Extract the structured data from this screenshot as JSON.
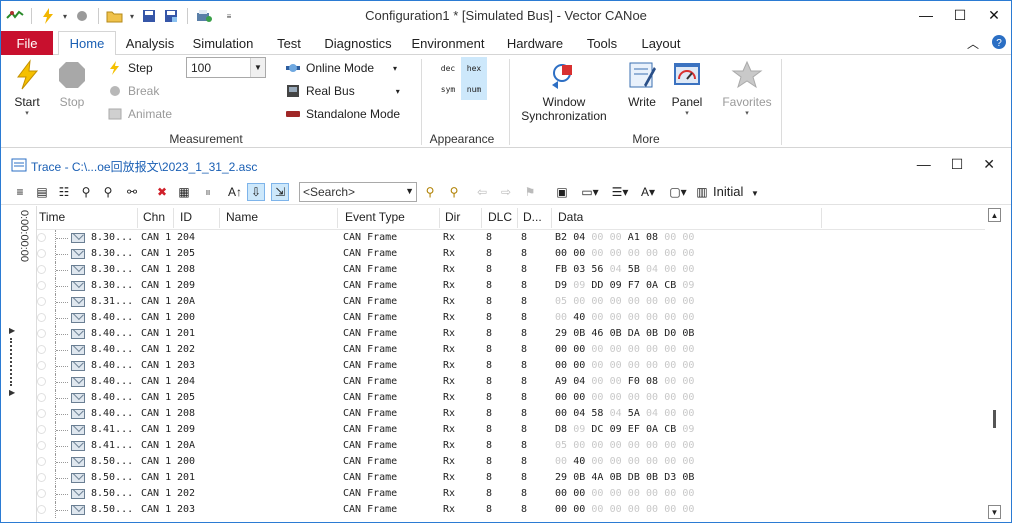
{
  "window": {
    "title": "Configuration1 * [Simulated Bus] - Vector CANoe"
  },
  "quick_access": {
    "icons": [
      "network-icon",
      "start-icon",
      "stop-icon",
      "open-folder-icon",
      "save-icon",
      "save-as-icon",
      "print-icon",
      "customize-icon"
    ]
  },
  "ribbon_tabs": [
    "File",
    "Home",
    "Analysis",
    "Simulation",
    "Test",
    "Diagnostics",
    "Environment",
    "Hardware",
    "Tools",
    "Layout"
  ],
  "ribbon": {
    "measurement": {
      "label": "Measurement",
      "start": "Start",
      "stop": "Stop",
      "step": "Step",
      "break": "Break",
      "animate": "Animate",
      "speed_value": "100",
      "online_mode": "Online Mode",
      "real_bus": "Real Bus",
      "standalone_mode": "Standalone Mode"
    },
    "appearance": {
      "label": "Appearance",
      "formats": [
        "dec",
        "hex",
        "sym",
        "num"
      ]
    },
    "more": {
      "label": "More",
      "window_sync_line1": "Window",
      "window_sync_line2": "Synchronization",
      "write": "Write",
      "panel": "Panel",
      "favorites": "Favorites"
    }
  },
  "trace": {
    "title": "Trace - C:\\...oe回放报文\\2023_1_31_2.asc",
    "search_placeholder": "<Search>",
    "layout_label": "Initial",
    "time_stamp": "0:00:00:00",
    "columns": [
      "Time",
      "Chn",
      "ID",
      "Name",
      "Event Type",
      "Dir",
      "DLC",
      "D...",
      "Data"
    ],
    "rows": [
      {
        "time": "8.30...",
        "chn": "CAN 1",
        "id": "204",
        "name": "",
        "event": "CAN Frame",
        "dir": "Rx",
        "dlc": "8",
        "d": "8",
        "data": [
          "B2",
          "04",
          "00",
          "00",
          "A1",
          "08",
          "00",
          "00"
        ],
        "faint": [
          2,
          3,
          6,
          7
        ]
      },
      {
        "time": "8.30...",
        "chn": "CAN 1",
        "id": "205",
        "name": "",
        "event": "CAN Frame",
        "dir": "Rx",
        "dlc": "8",
        "d": "8",
        "data": [
          "00",
          "00",
          "00",
          "00",
          "00",
          "00",
          "00",
          "00"
        ],
        "faint": [
          2,
          3,
          4,
          5,
          6,
          7
        ]
      },
      {
        "time": "8.30...",
        "chn": "CAN 1",
        "id": "208",
        "name": "",
        "event": "CAN Frame",
        "dir": "Rx",
        "dlc": "8",
        "d": "8",
        "data": [
          "FB",
          "03",
          "56",
          "04",
          "5B",
          "04",
          "00",
          "00"
        ],
        "faint": [
          3,
          5,
          6,
          7
        ]
      },
      {
        "time": "8.30...",
        "chn": "CAN 1",
        "id": "209",
        "name": "",
        "event": "CAN Frame",
        "dir": "Rx",
        "dlc": "8",
        "d": "8",
        "data": [
          "D9",
          "09",
          "DD",
          "09",
          "F7",
          "0A",
          "CB",
          "09"
        ],
        "faint": [
          1,
          7
        ]
      },
      {
        "time": "8.31...",
        "chn": "CAN 1",
        "id": "20A",
        "name": "",
        "event": "CAN Frame",
        "dir": "Rx",
        "dlc": "8",
        "d": "8",
        "data": [
          "05",
          "00",
          "00",
          "00",
          "00",
          "00",
          "00",
          "00"
        ],
        "faint": [
          0,
          1,
          2,
          3,
          4,
          5,
          6,
          7
        ]
      },
      {
        "time": "8.40...",
        "chn": "CAN 1",
        "id": "200",
        "name": "",
        "event": "CAN Frame",
        "dir": "Rx",
        "dlc": "8",
        "d": "8",
        "data": [
          "00",
          "40",
          "00",
          "00",
          "00",
          "00",
          "00",
          "00"
        ],
        "faint": [
          0,
          2,
          3,
          4,
          5,
          6,
          7
        ]
      },
      {
        "time": "8.40...",
        "chn": "CAN 1",
        "id": "201",
        "name": "",
        "event": "CAN Frame",
        "dir": "Rx",
        "dlc": "8",
        "d": "8",
        "data": [
          "29",
          "0B",
          "46",
          "0B",
          "DA",
          "0B",
          "D0",
          "0B"
        ],
        "faint": []
      },
      {
        "time": "8.40...",
        "chn": "CAN 1",
        "id": "202",
        "name": "",
        "event": "CAN Frame",
        "dir": "Rx",
        "dlc": "8",
        "d": "8",
        "data": [
          "00",
          "00",
          "00",
          "00",
          "00",
          "00",
          "00",
          "00"
        ],
        "faint": [
          2,
          3,
          4,
          5,
          6,
          7
        ]
      },
      {
        "time": "8.40...",
        "chn": "CAN 1",
        "id": "203",
        "name": "",
        "event": "CAN Frame",
        "dir": "Rx",
        "dlc": "8",
        "d": "8",
        "data": [
          "00",
          "00",
          "00",
          "00",
          "00",
          "00",
          "00",
          "00"
        ],
        "faint": [
          2,
          3,
          4,
          5,
          6,
          7
        ]
      },
      {
        "time": "8.40...",
        "chn": "CAN 1",
        "id": "204",
        "name": "",
        "event": "CAN Frame",
        "dir": "Rx",
        "dlc": "8",
        "d": "8",
        "data": [
          "A9",
          "04",
          "00",
          "00",
          "F0",
          "08",
          "00",
          "00"
        ],
        "faint": [
          2,
          3,
          6,
          7
        ]
      },
      {
        "time": "8.40...",
        "chn": "CAN 1",
        "id": "205",
        "name": "",
        "event": "CAN Frame",
        "dir": "Rx",
        "dlc": "8",
        "d": "8",
        "data": [
          "00",
          "00",
          "00",
          "00",
          "00",
          "00",
          "00",
          "00"
        ],
        "faint": [
          2,
          3,
          4,
          5,
          6,
          7
        ]
      },
      {
        "time": "8.40...",
        "chn": "CAN 1",
        "id": "208",
        "name": "",
        "event": "CAN Frame",
        "dir": "Rx",
        "dlc": "8",
        "d": "8",
        "data": [
          "00",
          "04",
          "58",
          "04",
          "5A",
          "04",
          "00",
          "00"
        ],
        "faint": [
          3,
          5,
          6,
          7
        ]
      },
      {
        "time": "8.41...",
        "chn": "CAN 1",
        "id": "209",
        "name": "",
        "event": "CAN Frame",
        "dir": "Rx",
        "dlc": "8",
        "d": "8",
        "data": [
          "D8",
          "09",
          "DC",
          "09",
          "EF",
          "0A",
          "CB",
          "09"
        ],
        "faint": [
          1,
          7
        ]
      },
      {
        "time": "8.41...",
        "chn": "CAN 1",
        "id": "20A",
        "name": "",
        "event": "CAN Frame",
        "dir": "Rx",
        "dlc": "8",
        "d": "8",
        "data": [
          "05",
          "00",
          "00",
          "00",
          "00",
          "00",
          "00",
          "00"
        ],
        "faint": [
          0,
          1,
          2,
          3,
          4,
          5,
          6,
          7
        ]
      },
      {
        "time": "8.50...",
        "chn": "CAN 1",
        "id": "200",
        "name": "",
        "event": "CAN Frame",
        "dir": "Rx",
        "dlc": "8",
        "d": "8",
        "data": [
          "00",
          "40",
          "00",
          "00",
          "00",
          "00",
          "00",
          "00"
        ],
        "faint": [
          0,
          2,
          3,
          4,
          5,
          6,
          7
        ]
      },
      {
        "time": "8.50...",
        "chn": "CAN 1",
        "id": "201",
        "name": "",
        "event": "CAN Frame",
        "dir": "Rx",
        "dlc": "8",
        "d": "8",
        "data": [
          "29",
          "0B",
          "4A",
          "0B",
          "DB",
          "0B",
          "D3",
          "0B"
        ],
        "faint": []
      },
      {
        "time": "8.50...",
        "chn": "CAN 1",
        "id": "202",
        "name": "",
        "event": "CAN Frame",
        "dir": "Rx",
        "dlc": "8",
        "d": "8",
        "data": [
          "00",
          "00",
          "00",
          "00",
          "00",
          "00",
          "00",
          "00"
        ],
        "faint": [
          2,
          3,
          4,
          5,
          6,
          7
        ]
      },
      {
        "time": "8.50...",
        "chn": "CAN 1",
        "id": "203",
        "name": "",
        "event": "CAN Frame",
        "dir": "Rx",
        "dlc": "8",
        "d": "8",
        "data": [
          "00",
          "00",
          "00",
          "00",
          "00",
          "00",
          "00",
          "00"
        ],
        "faint": [
          2,
          3,
          4,
          5,
          6,
          7
        ]
      }
    ]
  },
  "colors": {
    "file_tab": "#c8102e",
    "accent": "#1a5fb4",
    "selected_bg": "#cde8fb"
  }
}
